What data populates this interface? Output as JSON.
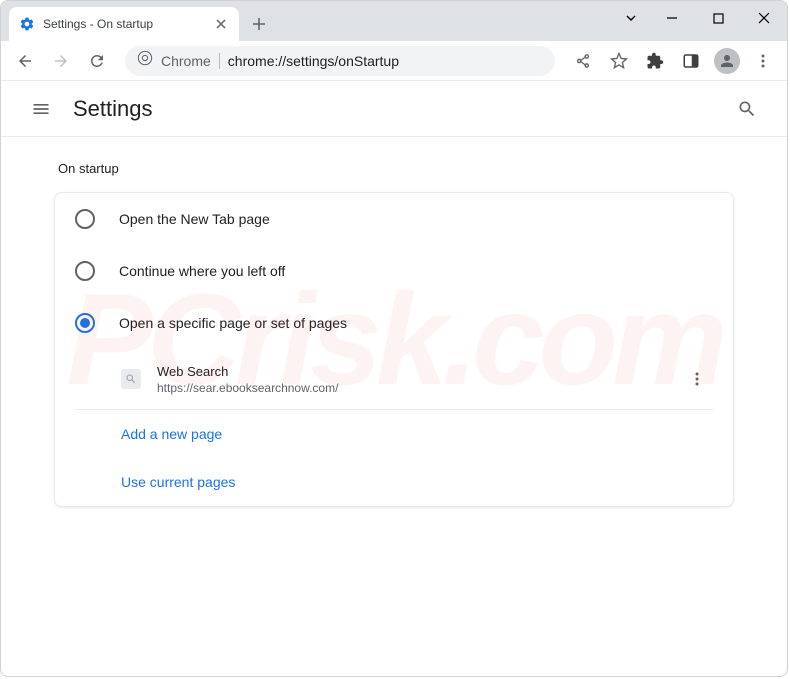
{
  "tab": {
    "title": "Settings - On startup"
  },
  "omnibox": {
    "prefix": "Chrome",
    "url": "chrome://settings/onStartup"
  },
  "header": {
    "title": "Settings"
  },
  "section": {
    "title": "On startup",
    "options": {
      "newtab": "Open the New Tab page",
      "continue": "Continue where you left off",
      "specific": "Open a specific page or set of pages"
    }
  },
  "page_entry": {
    "name": "Web Search",
    "url": "https://sear.ebooksearchnow.com/"
  },
  "actions": {
    "add": "Add a new page",
    "current": "Use current pages"
  },
  "watermark": "PCrisk.com"
}
